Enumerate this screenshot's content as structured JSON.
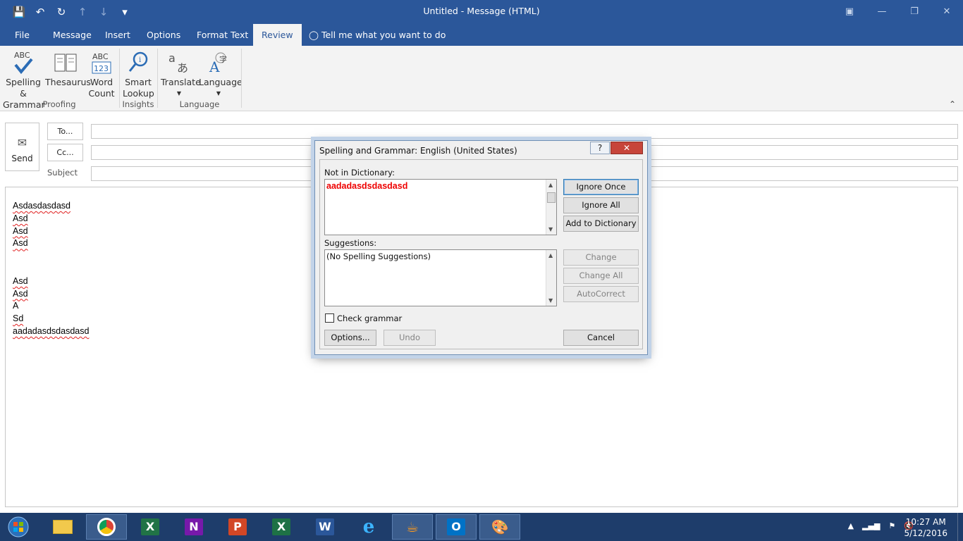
{
  "window": {
    "title": "Untitled - Message (HTML)"
  },
  "menu": {
    "tabs": [
      "File",
      "Message",
      "Insert",
      "Options",
      "Format Text",
      "Review"
    ],
    "tell_me": "Tell me what you want to do"
  },
  "ribbon": {
    "spelling": {
      "line1": "Spelling &",
      "line2": "Grammar"
    },
    "thesaurus": "Thesaurus",
    "word_count": {
      "line1": "Word",
      "line2": "Count"
    },
    "smart_lookup": {
      "line1": "Smart",
      "line2": "Lookup"
    },
    "translate": "Translate",
    "language": "Language",
    "groups": {
      "proofing": "Proofing",
      "insights": "Insights",
      "language": "Language"
    }
  },
  "compose": {
    "send": "Send",
    "to_button": "To...",
    "cc_button": "Cc...",
    "subject_label": "Subject",
    "body_lines": [
      "Asdasdasdasd",
      "Asd",
      "Asd",
      "Asd",
      "",
      "",
      "Asd",
      "Asd",
      "A",
      "Sd",
      "aadadasdsdasdasd"
    ]
  },
  "dialog": {
    "title": "Spelling and Grammar: English (United States)",
    "help": "?",
    "not_in_dictionary_label": "Not in Dictionary:",
    "misspelled_word": "aadadasdsdasdasd",
    "suggestions_label": "Suggestions:",
    "suggestion_text": "(No Spelling Suggestions)",
    "check_grammar_label": "Check grammar",
    "check_grammar_checked": false,
    "buttons": {
      "ignore_once": "Ignore Once",
      "ignore_all": "Ignore All",
      "add_to_dictionary": "Add to Dictionary",
      "change": "Change",
      "change_all": "Change All",
      "autocorrect": "AutoCorrect",
      "options": "Options...",
      "undo": "Undo",
      "cancel": "Cancel"
    }
  },
  "taskbar": {
    "time": "10:27 AM",
    "date": "5/12/2016"
  }
}
